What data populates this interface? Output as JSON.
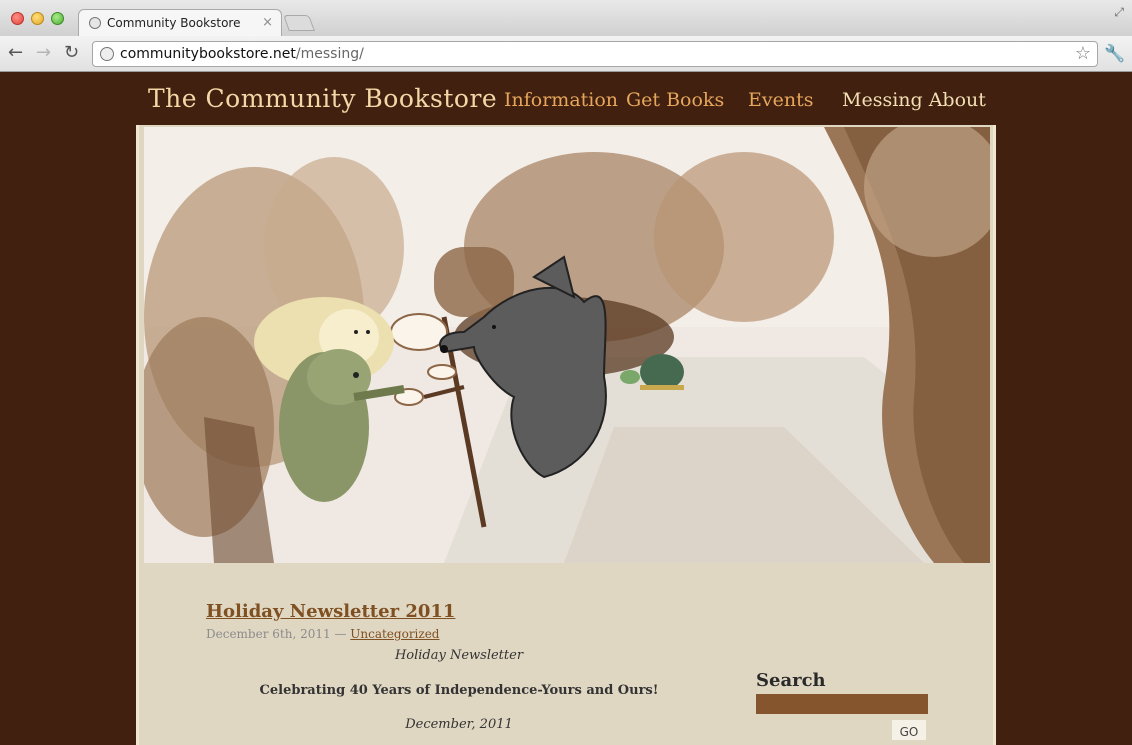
{
  "browser": {
    "tab_title": "Community Bookstore",
    "tab_close": "×",
    "url_host": "communitybookstore.net",
    "url_path": "/messing/"
  },
  "site": {
    "title": "The Community Bookstore",
    "nav": [
      "Information",
      "Get Books",
      "Events",
      "Messing About"
    ]
  },
  "post": {
    "title": "Holiday Newsletter 2011",
    "date": "December 6th, 2011",
    "separator": " — ",
    "category": "Uncategorized",
    "lines": [
      "Holiday Newsletter",
      "Celebrating 40 Years of Independence-Yours and Ours!",
      "December, 2011"
    ]
  },
  "sidebar": {
    "search_title": "Search",
    "search_value": "",
    "go_label": "GO"
  },
  "colors": {
    "page_bg": "#41200f",
    "content_bg": "#e0d7c3",
    "link": "#7e5022",
    "nav": "#e6a65c"
  }
}
